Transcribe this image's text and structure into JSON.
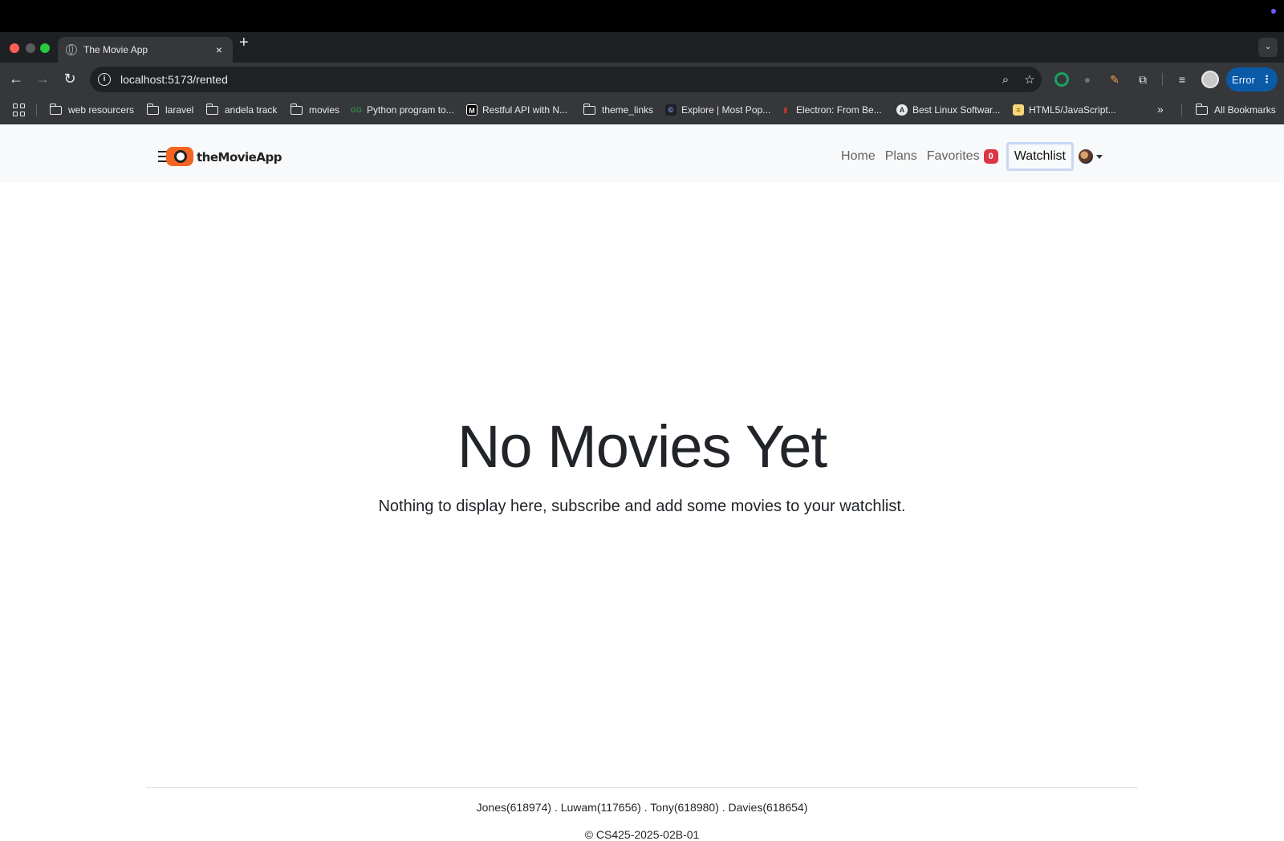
{
  "browser": {
    "tab_title": "The Movie App",
    "tab_close": "×",
    "new_tab": "+",
    "tab_menu": "⌄",
    "url": "localhost:5173/rented",
    "info_glyph": "i",
    "zoom_glyph": "⌕",
    "star_glyph": "☆",
    "back_glyph": "←",
    "forward_glyph": "→",
    "reload_glyph": "↻",
    "profile_button": "Error",
    "profile_menu": "⋮",
    "more_bookmarks": "»",
    "bookmarks": [
      {
        "label": "web resourcers",
        "icon": "folder-icon"
      },
      {
        "label": "laravel",
        "icon": "folder-icon"
      },
      {
        "label": "andela track",
        "icon": "folder-icon"
      },
      {
        "label": "movies",
        "icon": "folder-icon"
      },
      {
        "label": "Python program to...",
        "icon": "geeksforgeeks-icon"
      },
      {
        "label": "Restful API with N...",
        "icon": "medium-icon"
      },
      {
        "label": "theme_links",
        "icon": "folder-icon"
      },
      {
        "label": "Explore | Most Pop...",
        "icon": "explore-icon"
      },
      {
        "label": "Electron: From Be...",
        "icon": "electron-icon"
      },
      {
        "label": "Best Linux Softwar...",
        "icon": "linux-icon"
      },
      {
        "label": "HTML5/JavaScript...",
        "icon": "html-icon"
      },
      {
        "label": "All Bookmarks",
        "icon": "folder-icon"
      }
    ],
    "colors": {
      "error_pill": "#0a5aa8",
      "toolbar": "#36373a"
    }
  },
  "app": {
    "brand": "theMovieApp",
    "nav": {
      "home": "Home",
      "plans": "Plans",
      "favorites": "Favorites",
      "favorites_count": "0",
      "watchlist": "Watchlist"
    },
    "hero": {
      "title": "No Movies Yet",
      "subtitle": "Nothing to display here, subscribe and add some movies to your watchlist."
    },
    "footer": {
      "names": "Jones(618974) . Luwam(117656) . Tony(618980) . Davies(618654)",
      "copyright": "© CS425-2025-02B-01"
    },
    "colors": {
      "brand": "#f26522",
      "badge": "#dc3545",
      "nav_bg": "#f8f9fa"
    }
  }
}
